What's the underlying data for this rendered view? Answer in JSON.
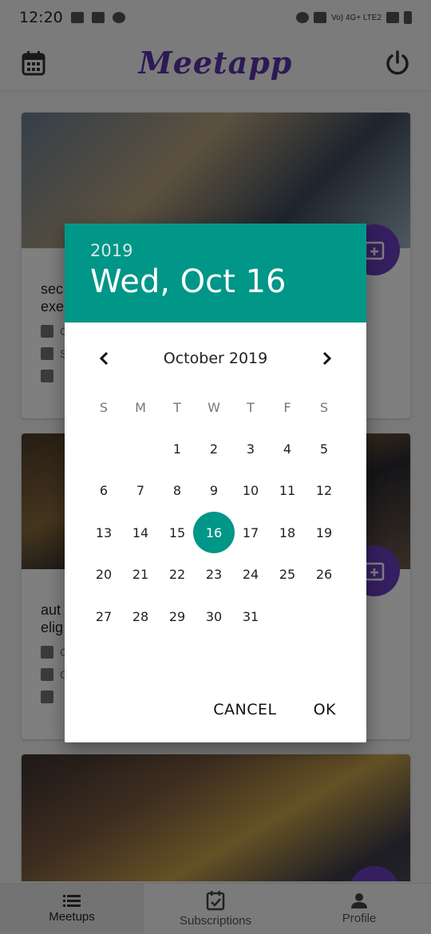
{
  "statusbar": {
    "time": "12:20",
    "network": "Vo) 4G+ LTE2"
  },
  "appbar": {
    "title": "Meetapp",
    "left_icon": "calendar-icon",
    "right_icon": "power-icon"
  },
  "cards": [
    {
      "title_lines": [
        "sec",
        "exe"
      ],
      "meta": [
        "C",
        "S",
        ""
      ]
    },
    {
      "title_lines": [
        "aut",
        "elig"
      ],
      "meta": [
        "C",
        "C",
        ""
      ]
    },
    {
      "title_lines": [],
      "meta": []
    }
  ],
  "tabs": [
    {
      "label": "Meetups",
      "icon": "list-icon",
      "active": true
    },
    {
      "label": "Subscriptions",
      "icon": "calendar-check-icon",
      "active": false
    },
    {
      "label": "Profile",
      "icon": "person-icon",
      "active": false
    }
  ],
  "dialog": {
    "year": "2019",
    "selected_date": "Wed, Oct 16",
    "month_label": "October 2019",
    "weekdays": [
      "S",
      "M",
      "T",
      "W",
      "T",
      "F",
      "S"
    ],
    "leading_blanks": 2,
    "days": [
      1,
      2,
      3,
      4,
      5,
      6,
      7,
      8,
      9,
      10,
      11,
      12,
      13,
      14,
      15,
      16,
      17,
      18,
      19,
      20,
      21,
      22,
      23,
      24,
      25,
      26,
      27,
      28,
      29,
      30,
      31
    ],
    "selected_day": 16,
    "cancel_label": "CANCEL",
    "ok_label": "OK",
    "accent_color": "#009688"
  }
}
